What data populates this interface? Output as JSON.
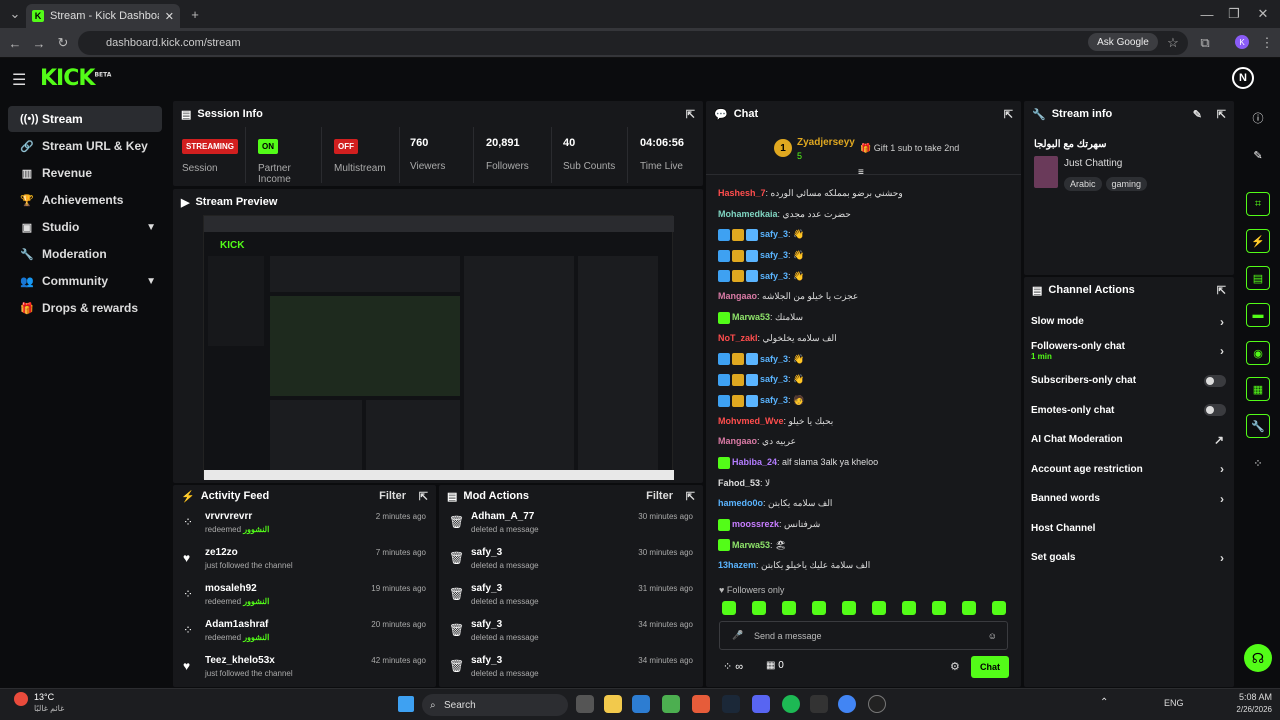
{
  "browser": {
    "tab_title": "Stream - Kick Dashboard",
    "url": "dashboard.kick.com/stream",
    "ask_google": "Ask Google",
    "profile_letter": "K"
  },
  "header": {
    "logo": "KICK",
    "logo_sup": "BETA",
    "avatar_letter": "N"
  },
  "sidebar": {
    "items": [
      {
        "label": "Stream",
        "icon": "broadcast-icon"
      },
      {
        "label": "Stream URL & Key",
        "icon": "link-icon"
      },
      {
        "label": "Revenue",
        "icon": "chart-icon"
      },
      {
        "label": "Achievements",
        "icon": "trophy-icon"
      },
      {
        "label": "Studio",
        "icon": "studio-icon"
      },
      {
        "label": "Moderation",
        "icon": "wrench-icon"
      },
      {
        "label": "Community",
        "icon": "people-icon"
      },
      {
        "label": "Drops & rewards",
        "icon": "gift-icon"
      }
    ]
  },
  "session": {
    "title": "Session Info",
    "streaming": "STREAMING",
    "session_label": "Session",
    "partner_badge": "ON",
    "partner_label": "Partner Income",
    "multistream_badge": "OFF",
    "multistream_label": "Multistream",
    "viewers": "760",
    "viewers_label": "Viewers",
    "followers": "20,891",
    "followers_label": "Followers",
    "subs": "40",
    "subs_label": "Sub Counts",
    "time_live": "04:06:56",
    "time_live_label": "Time Live"
  },
  "preview": {
    "title": "Stream Preview"
  },
  "activity": {
    "title": "Activity Feed",
    "filter": "Filter",
    "items": [
      {
        "name": "vrvrvrevrr",
        "sub": "redeemed",
        "reward": "النشوور",
        "time": "2 minutes ago"
      },
      {
        "name": "ze12zo",
        "sub": "just followed the channel",
        "reward": "",
        "time": "7 minutes ago"
      },
      {
        "name": "mosaleh92",
        "sub": "redeemed",
        "reward": "النشوور",
        "time": "19 minutes ago"
      },
      {
        "name": "Adam1ashraf",
        "sub": "redeemed",
        "reward": "النشوور",
        "time": "20 minutes ago"
      },
      {
        "name": "Teez_khelo53x",
        "sub": "just followed the channel",
        "reward": "",
        "time": "42 minutes ago"
      }
    ]
  },
  "mod": {
    "title": "Mod Actions",
    "filter": "Filter",
    "items": [
      {
        "name": "Adham_A_77",
        "sub": "deleted a message",
        "time": "30 minutes ago"
      },
      {
        "name": "safy_3",
        "sub": "deleted a message",
        "time": "30 minutes ago"
      },
      {
        "name": "safy_3",
        "sub": "deleted a message",
        "time": "31 minutes ago"
      },
      {
        "name": "safy_3",
        "sub": "deleted a message",
        "time": "34 minutes ago"
      },
      {
        "name": "safy_3",
        "sub": "deleted a message",
        "time": "34 minutes ago"
      }
    ]
  },
  "chat": {
    "title": "Chat",
    "top_user": "Zyadjerseyy",
    "top_rank": "1",
    "top_count": "5",
    "gift_text": "Gift 1 sub to take 2nd",
    "followers_only": "Followers only",
    "input_placeholder": "Send a message",
    "chat_button": "Chat",
    "count_infinite": "∞",
    "count_zero": "0",
    "messages": [
      {
        "user": "Hashesh_7",
        "color": "#ff4d4d",
        "text": "وحشني برضو بمملكه مسائي الورده"
      },
      {
        "user": "Mohamedkaia",
        "color": "#7fd4c1",
        "text": "حضرت عدد مجدي"
      },
      {
        "user": "safy_3",
        "color": "#5ab4ff",
        "text": "👋"
      },
      {
        "user": "safy_3",
        "color": "#5ab4ff",
        "text": "👋"
      },
      {
        "user": "safy_3",
        "color": "#5ab4ff",
        "text": "👋"
      },
      {
        "user": "Mangaao",
        "color": "#d97aa5",
        "text": "عجزت يا خيلو من الجلاشه"
      },
      {
        "user": "Marwa53",
        "color": "#8ee36a",
        "text": "سلامتك"
      },
      {
        "user": "NoT_zakI",
        "color": "#ff4d4d",
        "text": "الف سلامه يخلخولي"
      },
      {
        "user": "safy_3",
        "color": "#5ab4ff",
        "text": "👋"
      },
      {
        "user": "safy_3",
        "color": "#5ab4ff",
        "text": "👋"
      },
      {
        "user": "safy_3",
        "color": "#5ab4ff",
        "text": "🧑"
      },
      {
        "user": "Mohvmed_Wve",
        "color": "#ff4d4d",
        "text": "بحبك يا خيلو"
      },
      {
        "user": "Mangaao",
        "color": "#d97aa5",
        "text": "عربيه دي"
      },
      {
        "user": "Habiba_24",
        "color": "#b37cff",
        "text": "alf slama 3alk ya kheloo"
      },
      {
        "user": "Fahod_53",
        "color": "#dddddd",
        "text": "لا"
      },
      {
        "user": "hamedo0o",
        "color": "#5ab4ff",
        "text": "الف سلامه يكابتن"
      },
      {
        "user": "moossrezk",
        "color": "#c77dff",
        "text": "شرفتانس"
      },
      {
        "user": "Marwa53",
        "color": "#8ee36a",
        "text": "🏖"
      },
      {
        "user": "13hazem",
        "color": "#5ab4ff",
        "text": "الف سلامة عليك ياخيلو يكابتن"
      }
    ]
  },
  "stream_info": {
    "title": "Stream info",
    "stream_title": "سهرتك مع البولجا",
    "category": "Just Chatting",
    "tags": [
      "Arabic",
      "gaming"
    ]
  },
  "channel_actions": {
    "title": "Channel Actions",
    "items": [
      {
        "label": "Slow mode",
        "sub": "",
        "control": "arrow"
      },
      {
        "label": "Followers-only chat",
        "sub": "1 min",
        "control": "arrow"
      },
      {
        "label": "Subscribers-only chat",
        "sub": "",
        "control": "toggle"
      },
      {
        "label": "Emotes-only chat",
        "sub": "",
        "control": "toggle"
      },
      {
        "label": "AI Chat Moderation",
        "sub": "",
        "control": "external"
      },
      {
        "label": "Account age restriction",
        "sub": "",
        "control": "arrow"
      },
      {
        "label": "Banned words",
        "sub": "",
        "control": "arrow"
      },
      {
        "label": "Host Channel",
        "sub": "",
        "control": "none"
      },
      {
        "label": "Set goals",
        "sub": "",
        "control": "arrow"
      }
    ]
  },
  "taskbar": {
    "weather_temp": "13°C",
    "weather_text": "غائم غالبًا",
    "search": "Search",
    "lang": "ENG",
    "time": "5:08 AM",
    "date": "2/26/2026"
  },
  "colors": {
    "accent": "#53fc18",
    "panel": "#17181b",
    "bg": "#0b0c0e",
    "streaming_red": "#d11f1f"
  }
}
